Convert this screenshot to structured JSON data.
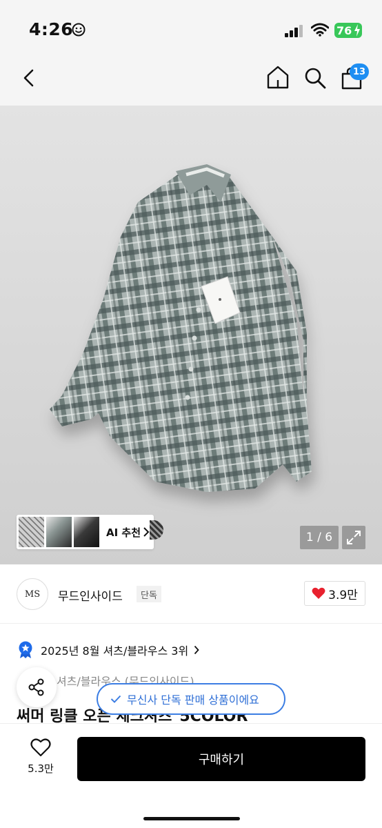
{
  "status_bar": {
    "time": "4:26",
    "battery": "76"
  },
  "nav": {
    "cart_count": "13"
  },
  "gallery": {
    "ai_label": "AI 추천",
    "page_indicator": "1 / 6"
  },
  "brand": {
    "logo_text": "MS",
    "name": "무드인사이드",
    "tag": "단독",
    "like_count": "3.9만"
  },
  "ranking": {
    "text": "2025년 8월 셔츠/블라우스 3위"
  },
  "product": {
    "category": "셔츠/블라우스 (무드인사이드)",
    "title": "써머 링클 오픈 체크셔츠_5COLOR"
  },
  "toast": {
    "text": "무신사 단독 판매 상품이에요"
  },
  "bottom_bar": {
    "wish_count": "5.3만",
    "buy_label": "구매하기"
  },
  "colors": {
    "accent_blue": "#3b7de3",
    "badge_blue": "#1e8ef2",
    "battery_green": "#38c759",
    "heart_red": "#e8212e"
  }
}
